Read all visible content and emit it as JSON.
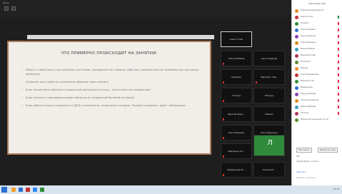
{
  "window": {
    "title": "Zoom"
  },
  "slide": {
    "title": "ЧТО ПРИМЕРНО ПРОИСХОДИТ НА ЗАНЯТИИ:",
    "bullets": [
      "Работа с приветами и настроением участников, проведение их к общему рабочему знаменателю (не забываем про групповую динамику)",
      "Основная часть работы с развитием общения через картину",
      "Блок закрепления общения в привычной деятельности (игра - настольная или подвижная)",
      "Блок тренинга (тренировки навыка общения в стандартной бытовой ситуации)",
      "Блок работы второго специалиста (ДПД, старательно, социальные истории). Первый специалист ведёт наблюдение."
    ]
  },
  "tiles": [
    "Анна Устина",
    "Тимур Минбаев",
    "Анна Сидорова",
    "Надежда",
    "Маргарит. Пар..",
    "Татьяна",
    "Наталья",
    "Бекатий Ферм...",
    "Михаил",
    "Ольга Балдина",
    "Ольга Вдовенко",
    "Маргарита Эл...",
    "Л",
    "Байдеромов Эл...",
    "Наталья Р..."
  ],
  "panel": {
    "title": "Участники (18)",
    "participants": [
      "Надежда Кириллова (я)",
      "Анна Устина",
      "Наталья",
      "Ольга Балдина",
      "Анна Сидорова",
      "Ольга Вдовенко",
      "Бекатий Ферм",
      "Маргарита Пар",
      "Наталья Р",
      "Михаил",
      "Ольга Бердникова",
      "Маргарита Эл",
      "Байдеромов",
      "Тимур Минбаев",
      "Наталья Тетерина",
      "Ирина Ефимова",
      "Татьяна",
      "Михаил Котельников (гость)"
    ],
    "invite_button": "Пригласить",
    "mute_button": "Выключить звук",
    "chat_label": "Чат",
    "chat_sample": "здравствуйте, коллеги",
    "to_label": "Кому: Все",
    "input_placeholder": "Введите сообщение..."
  },
  "taskbar": {
    "clock": "12:12"
  },
  "colors": {
    "accent": "#a87a58",
    "mic_off": "#e22244",
    "avatars": [
      "#e88a2a",
      "#c43131",
      "#2f8a3b",
      "#2a6fd1",
      "#8a3fb3",
      "#d98c1e",
      "#3a9ec2",
      "#b5335a",
      "#5b8a2a"
    ]
  }
}
